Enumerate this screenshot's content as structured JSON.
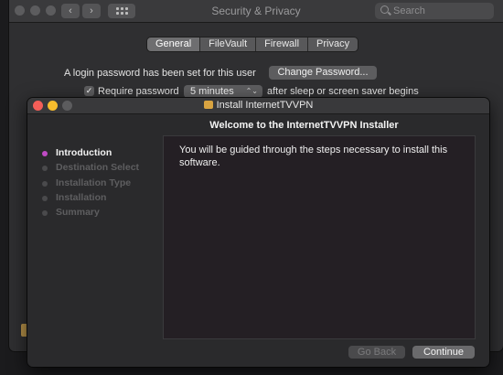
{
  "prefs_window": {
    "title": "Security & Privacy",
    "search_placeholder": "Search",
    "back_glyph": "‹",
    "forward_glyph": "›",
    "tabs": [
      {
        "label": "General",
        "active": true
      },
      {
        "label": "FileVault",
        "active": false
      },
      {
        "label": "Firewall",
        "active": false
      },
      {
        "label": "Privacy",
        "active": false
      }
    ],
    "login_text": "A login password has been set for this user",
    "change_password_label": "Change Password...",
    "require_password_label": "Require password",
    "require_password_checked": true,
    "require_password_delay": "5 minutes",
    "after_sleep_text": "after sleep or screen saver begins"
  },
  "installer": {
    "title": "Install InternetTVVPN",
    "heading": "Welcome to the InternetTVVPN Installer",
    "steps": [
      {
        "label": "Introduction",
        "active": true
      },
      {
        "label": "Destination Select",
        "active": false
      },
      {
        "label": "Installation Type",
        "active": false
      },
      {
        "label": "Installation",
        "active": false
      },
      {
        "label": "Summary",
        "active": false
      }
    ],
    "body_text": "You will be guided through the steps necessary to install this software.",
    "go_back_label": "Go Back",
    "continue_label": "Continue"
  },
  "colors": {
    "active_step_dot": "#c04bc5",
    "close_light": "#f45e58",
    "minimize_light": "#f8bd2d"
  },
  "icons": {
    "search": "search-icon",
    "grid": "show-all-grid-icon",
    "checkbox": "checkmark-icon",
    "package": "package-icon"
  }
}
